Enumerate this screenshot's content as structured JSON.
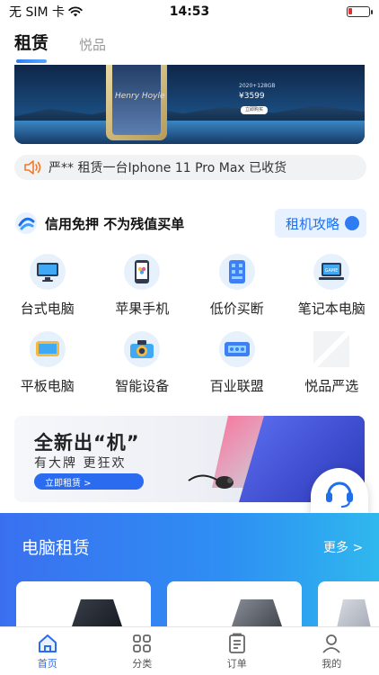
{
  "status_bar": {
    "carrier": "无 SIM 卡",
    "time": "14:53"
  },
  "top_tabs": [
    {
      "label": "租赁",
      "active": true
    },
    {
      "label": "悦品",
      "active": false
    }
  ],
  "hero_banner": {
    "signature": "Henry Hoyle",
    "price": "¥3599",
    "price_note": "2020+128GB",
    "buy_label": "立即购买"
  },
  "notice": {
    "text": "严** 租赁一台Iphone 11 Pro Max 已收货"
  },
  "credit": {
    "slogan": "信用免押 不为残值买单",
    "guide_label": "租机攻略"
  },
  "categories": [
    {
      "label": "台式电脑",
      "icon": "desktop-monitor-icon"
    },
    {
      "label": "苹果手机",
      "icon": "smartphone-icon"
    },
    {
      "label": "低价买断",
      "icon": "phone-buyout-icon"
    },
    {
      "label": "笔记本电脑",
      "icon": "laptop-icon"
    },
    {
      "label": "平板电脑",
      "icon": "tablet-icon"
    },
    {
      "label": "智能设备",
      "icon": "camera-icon"
    },
    {
      "label": "百业联盟",
      "icon": "alliance-icon"
    },
    {
      "label": "悦品严选",
      "icon": "selection-placeholder-icon"
    }
  ],
  "promo_banner": {
    "title": "全新出“机”",
    "subtitle": "有大牌 更狂欢",
    "cta": "立即租赁 >"
  },
  "service_float": {
    "label": "客服"
  },
  "computer_section": {
    "title": "电脑租赁",
    "more": "更多 >"
  },
  "tabbar": [
    {
      "label": "首页",
      "icon": "home-icon",
      "active": true
    },
    {
      "label": "分类",
      "icon": "category-grid-icon",
      "active": false
    },
    {
      "label": "订单",
      "icon": "order-list-icon",
      "active": false
    },
    {
      "label": "我的",
      "icon": "profile-icon",
      "active": false
    }
  ],
  "colors": {
    "accent": "#2a6bf0",
    "section_bg_start": "#3a70f0",
    "section_bg_end": "#2fb8ee",
    "battery_low": "#e03030"
  }
}
